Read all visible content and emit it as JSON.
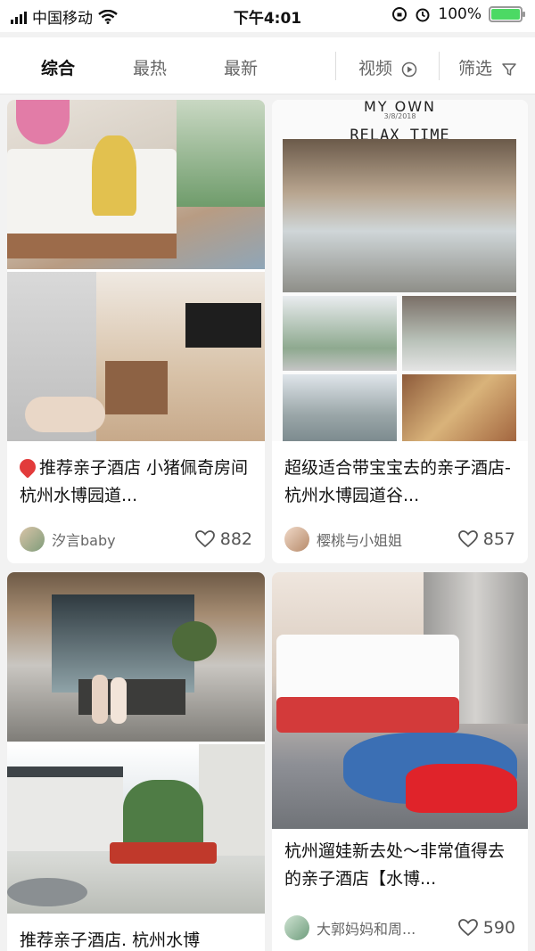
{
  "status_bar": {
    "carrier": "中国移动",
    "time": "下午4:01",
    "battery": "100%",
    "battery_level": 1.0
  },
  "tabs": [
    {
      "label": "综合",
      "active": true
    },
    {
      "label": "最热",
      "active": false
    },
    {
      "label": "最新",
      "active": false
    }
  ],
  "video_filter": {
    "label": "视频",
    "icon": "play-circle-icon"
  },
  "filter": {
    "label": "筛选",
    "icon": "funnel-icon"
  },
  "cards": [
    {
      "badge_icon": "fire-icon",
      "title": "推荐亲子酒店 小猪佩奇房间 杭州水博园道...",
      "author": "汐言baby",
      "likes": "882"
    },
    {
      "image_text_top": "MY OWN",
      "image_date": "3/8/2018",
      "image_text": "RELAX TIME",
      "title": "超级适合带宝宝去的亲子酒店-杭州水博园道谷...",
      "author": "樱桃与小姐姐",
      "likes": "857"
    },
    {
      "title": "推荐亲子酒店. 杭州水博",
      "author": "",
      "likes": ""
    },
    {
      "title": "杭州遛娃新去处～非常值得去的亲子酒店【水博...",
      "author": "大郭妈妈和周...",
      "likes": "590"
    }
  ],
  "colors": {
    "accent": "#e23b3b",
    "battery": "#4cd964",
    "background": "#f2f2f2"
  }
}
